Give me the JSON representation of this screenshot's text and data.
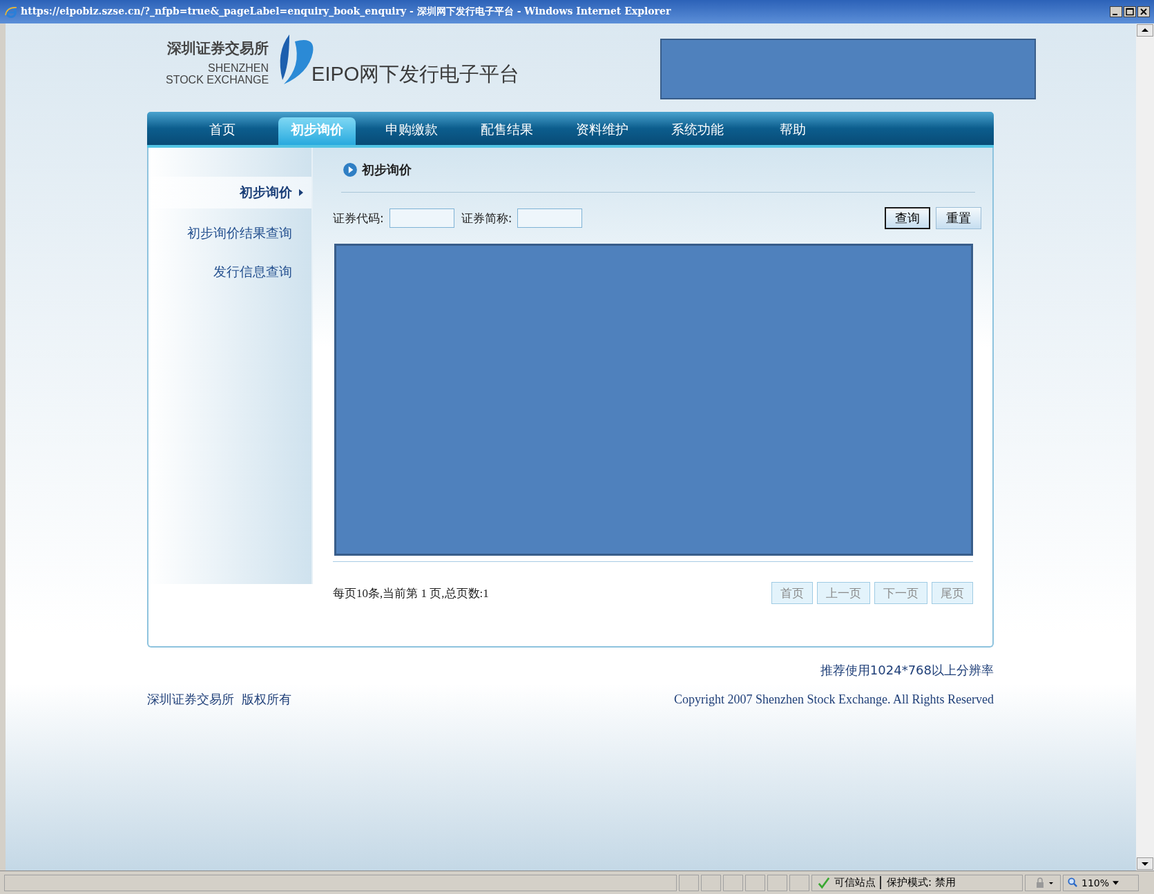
{
  "window": {
    "title": "https://eipobiz.szse.cn/?_nfpb=true&_pageLabel=enquiry_book_enquiry - 深圳网下发行电子平台 - Windows Internet Explorer"
  },
  "header": {
    "logo_cn": "深圳证券交易所",
    "logo_en_1": "SHENZHEN",
    "logo_en_2": "STOCK EXCHANGE",
    "platform_title": "EIPO网下发行电子平台"
  },
  "nav": {
    "tabs": [
      {
        "label": "首页",
        "selected": false
      },
      {
        "label": "初步询价",
        "selected": true
      },
      {
        "label": "申购缴款",
        "selected": false
      },
      {
        "label": "配售结果",
        "selected": false
      },
      {
        "label": "资料维护",
        "selected": false
      },
      {
        "label": "系统功能",
        "selected": false
      },
      {
        "label": "帮助",
        "selected": false
      }
    ]
  },
  "sidebar": {
    "items": [
      {
        "label": "初步询价",
        "selected": true
      },
      {
        "label": "初步询价结果查询",
        "selected": false
      },
      {
        "label": "发行信息查询",
        "selected": false
      }
    ]
  },
  "section_title": "初步询价",
  "search_form": {
    "fields": [
      {
        "label": "证券代码:"
      },
      {
        "label": "证券简称:"
      }
    ],
    "buttons": [
      {
        "label": "查询",
        "focused": true
      },
      {
        "label": "重置",
        "focused": false
      }
    ]
  },
  "pagination": {
    "summary": "每页10条,当前第 1 页,总页数:1",
    "buttons": [
      {
        "label": "首页",
        "disabled": true
      },
      {
        "label": "上一页",
        "disabled": true
      },
      {
        "label": "下一页",
        "disabled": true
      },
      {
        "label": "尾页",
        "disabled": true
      }
    ]
  },
  "footer": {
    "resolution_note": "推荐使用1024*768以上分辨率",
    "owner": "深圳证券交易所  版权所有",
    "copyright": "Copyright 2007 Shenzhen Stock Exchange. All Rights Reserved"
  },
  "status_bar": {
    "zone": "可信站点",
    "protected_mode": "保护模式: 禁用",
    "zoom": "110%"
  }
}
